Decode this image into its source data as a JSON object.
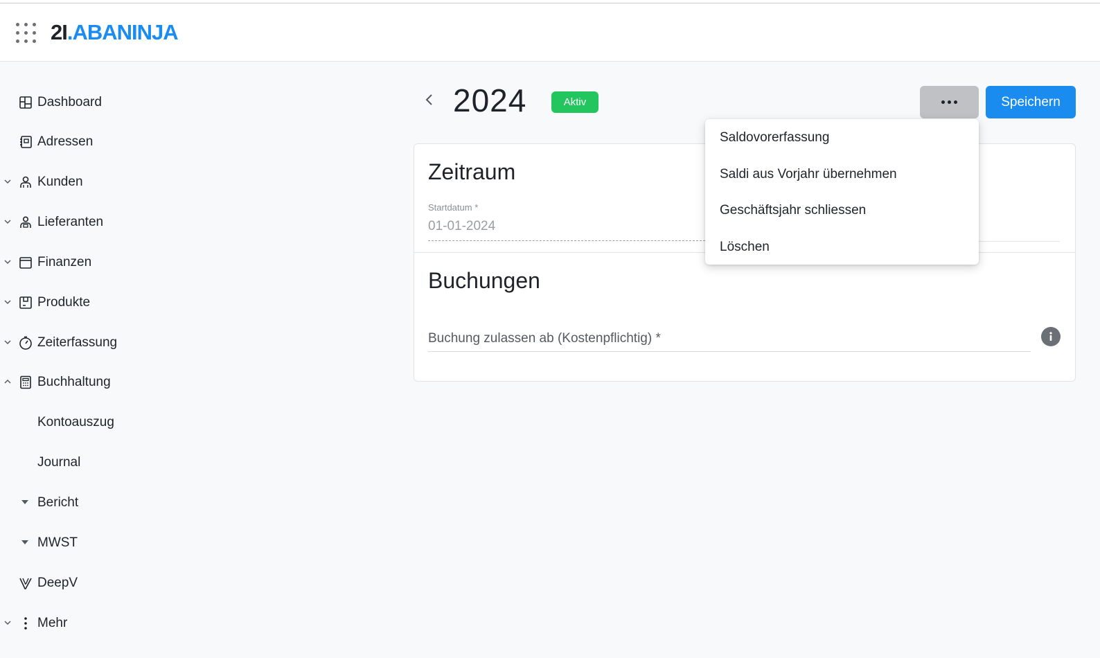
{
  "header": {
    "logo_number": "2I",
    "logo_dot": ".",
    "logo_brand": "ABANINJA"
  },
  "sidebar": {
    "items": [
      {
        "label": "Dashboard"
      },
      {
        "label": "Adressen"
      },
      {
        "label": "Kunden"
      },
      {
        "label": "Lieferanten"
      },
      {
        "label": "Finanzen"
      },
      {
        "label": "Produkte"
      },
      {
        "label": "Zeiterfassung"
      },
      {
        "label": "Buchhaltung"
      },
      {
        "label": "Kontoauszug"
      },
      {
        "label": "Journal"
      },
      {
        "label": "Bericht"
      },
      {
        "label": "MWST"
      },
      {
        "label": "DeepV"
      },
      {
        "label": "Mehr"
      }
    ]
  },
  "page": {
    "title": "2024",
    "status": "Aktiv",
    "save_label": "Speichern"
  },
  "zeitraum": {
    "title": "Zeitraum",
    "start_label": "Startdatum *",
    "start_value": "01-01-2024"
  },
  "buchungen": {
    "title": "Buchungen",
    "booking_placeholder": "Buchung zulassen ab (Kostenpflichtig) *"
  },
  "menu": {
    "items": [
      {
        "label": "Saldovorerfassung"
      },
      {
        "label": "Saldi aus Vorjahr übernehmen"
      },
      {
        "label": "Geschäftsjahr schliessen"
      },
      {
        "label": "Löschen"
      }
    ]
  },
  "colors": {
    "accent": "#1a8cf0",
    "status_active": "#22c55e",
    "more_button_bg": "#bfc1c4"
  }
}
